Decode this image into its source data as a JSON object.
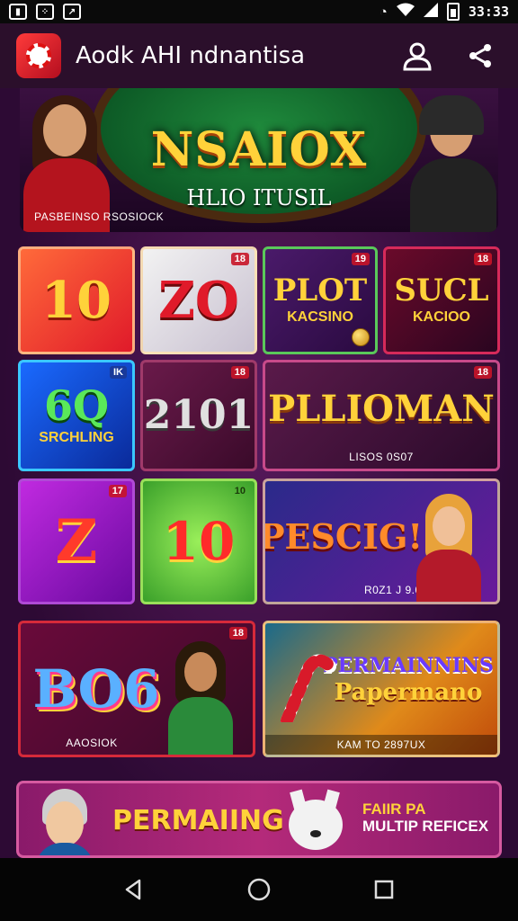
{
  "status_bar": {
    "time": "33:33",
    "left_icons": [
      "image-icon",
      "grid-icon",
      "arrow-icon"
    ],
    "right_icons": [
      "alarm-icon",
      "wifi-icon",
      "signal-icon",
      "battery-icon"
    ]
  },
  "app_bar": {
    "title": "Aodk AHI ndnantisa",
    "actions": [
      "profile-icon",
      "share-icon"
    ]
  },
  "hero": {
    "title": "NSAIOX",
    "subtitle": "HLIO ITUSIL",
    "caption": "PASBEINSO RSOSIOCK"
  },
  "tiles": [
    {
      "main": "10",
      "sub": "",
      "badge": "",
      "caption": ""
    },
    {
      "main": "ZO",
      "sub": "",
      "badge": "18",
      "caption": ""
    },
    {
      "main": "PLOT",
      "sub": "KACSINO",
      "badge": "19",
      "caption": ""
    },
    {
      "main": "SUCL",
      "sub": "KACIOO",
      "badge": "18",
      "caption": ""
    },
    {
      "main": "6Q",
      "sub": "SRCHLING",
      "badge": "IK",
      "caption": ""
    },
    {
      "main": "2101",
      "sub": "",
      "badge": "18",
      "caption": ""
    },
    {
      "main": "PLLIOMAN",
      "sub": "",
      "badge": "18",
      "caption": "LISOS 0S07"
    },
    {
      "main": "Z",
      "sub": "",
      "badge": "17",
      "caption": ""
    },
    {
      "main": "10",
      "sub": "",
      "badge": "10",
      "caption": ""
    },
    {
      "main": "PESCIG!",
      "sub": "",
      "badge": "",
      "caption": "R0Z1 J 9.005"
    },
    {
      "main": "BO6",
      "sub": "",
      "badge": "18",
      "caption": "AAOSIOK"
    },
    {
      "main": "PERMAINNINS",
      "sub": "Papermano",
      "badge": "",
      "caption": "KAM TO 2897UX"
    }
  ],
  "promo": {
    "title": "PERMAIING",
    "right_line1": "FAIIR PA",
    "right_line2": "MULTIP REFICEX"
  },
  "nav_bar": {
    "buttons": [
      "back-icon",
      "home-icon",
      "recents-icon"
    ]
  },
  "colors": {
    "background": "#2a0a2e",
    "appbar": "#2b0f2b",
    "gold": "#ffd23a",
    "red": "#c8142a"
  }
}
